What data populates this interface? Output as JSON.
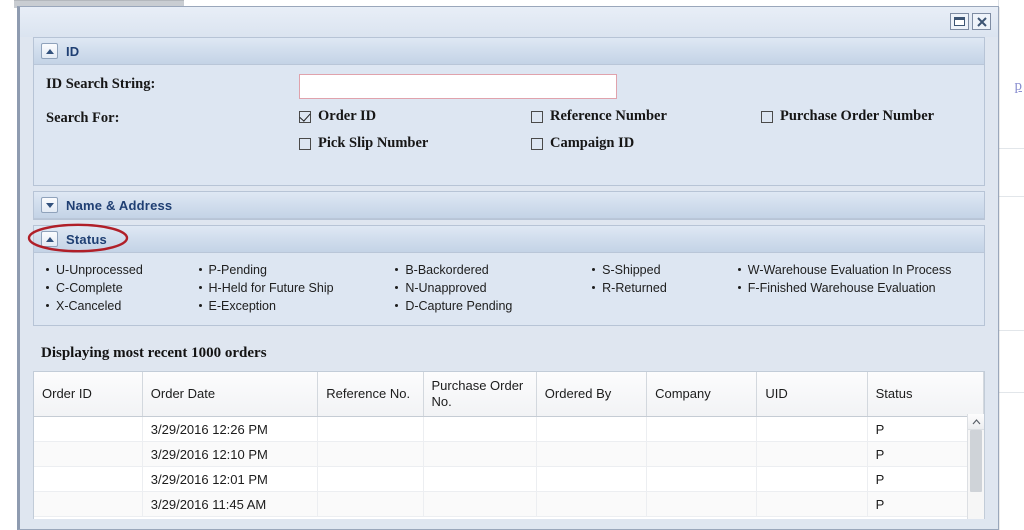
{
  "window": {
    "restore_label": "Restore",
    "close_label": "Close"
  },
  "background": {
    "link_fragment": "p"
  },
  "panels": {
    "id": {
      "title": "ID",
      "expanded": true,
      "toggle_icon": "triangle-up-icon",
      "search_label": "ID Search String:",
      "search_value": "",
      "search_placeholder": "",
      "search_for_label": "Search For:",
      "options": [
        {
          "label": "Order ID",
          "checked": true
        },
        {
          "label": "Reference Number",
          "checked": false
        },
        {
          "label": "Purchase Order Number",
          "checked": false
        },
        {
          "label": "Pick Slip Number",
          "checked": false
        },
        {
          "label": "Campaign ID",
          "checked": false
        }
      ]
    },
    "name_address": {
      "title": "Name & Address",
      "expanded": false,
      "toggle_icon": "triangle-down-icon"
    },
    "status": {
      "title": "Status",
      "expanded": true,
      "toggle_icon": "triangle-up-icon",
      "legend_columns": [
        [
          "U-Unprocessed",
          "C-Complete",
          "X-Canceled"
        ],
        [
          "P-Pending",
          "H-Held for Future Ship",
          "E-Exception"
        ],
        [
          "B-Backordered",
          "N-Unapproved",
          "D-Capture Pending"
        ],
        [
          "S-Shipped",
          "R-Returned"
        ],
        [
          "W-Warehouse Evaluation In Process",
          "F-Finished Warehouse Evaluation"
        ]
      ]
    }
  },
  "results": {
    "title": "Displaying most recent 1000 orders",
    "columns": [
      "Order ID",
      "Order Date",
      "Reference No.",
      "Purchase Order No.",
      "Ordered By",
      "Company",
      "UID",
      "Status"
    ],
    "rows": [
      {
        "order_id": "",
        "order_date": "3/29/2016 12:26 PM",
        "reference_no": "",
        "po_no": "",
        "ordered_by": "",
        "company": "",
        "uid": "",
        "status": "P"
      },
      {
        "order_id": "",
        "order_date": "3/29/2016 12:10 PM",
        "reference_no": "",
        "po_no": "",
        "ordered_by": "",
        "company": "",
        "uid": "",
        "status": "P"
      },
      {
        "order_id": "",
        "order_date": "3/29/2016 12:01 PM",
        "reference_no": "",
        "po_no": "",
        "ordered_by": "",
        "company": "",
        "uid": "",
        "status": "P"
      },
      {
        "order_id": "",
        "order_date": "3/29/2016 11:45 AM",
        "reference_no": "",
        "po_no": "",
        "ordered_by": "",
        "company": "",
        "uid": "",
        "status": "P"
      }
    ],
    "scrollbar": {
      "up_arrow": "chevron-up-icon"
    }
  },
  "annotation": {
    "shape": "ellipse",
    "color": "#b01f28",
    "target": "Status"
  }
}
